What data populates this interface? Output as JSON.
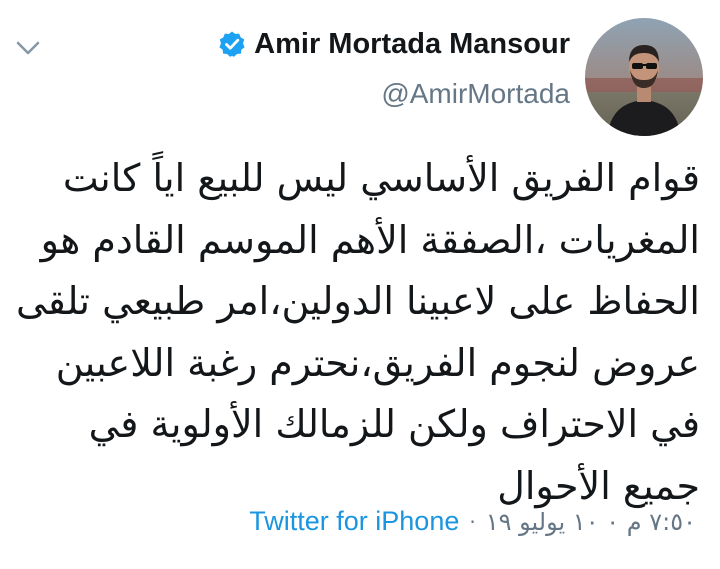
{
  "user": {
    "display_name": "Amir Mortada Mansour",
    "handle": "@AmirMortada",
    "verified": true
  },
  "icons": {
    "caret": "chevron-down-icon",
    "verified": "verified-badge-icon"
  },
  "tweet": {
    "lines": [
      "قوام الفريق الأساسي ليس للبيع اياً كانت",
      "المغريات ،الصفقة الأهم الموسم القادم هو",
      "الحفاظ على لاعبينا الدولين،امر طبيعي تلقى",
      "عروض لنجوم الفريق،نحترم رغبة اللاعبين",
      "في الاحتراف ولكن للزمالك الأولوية في",
      "جميع الأحوال"
    ]
  },
  "meta": {
    "timestamp": "٧:٥٠ م ٠ ١٠ يوليو ١٩",
    "separator": "·",
    "source": "Twitter for iPhone"
  },
  "colors": {
    "link_blue": "#1b95e0",
    "verified_blue": "#1da1f2",
    "secondary_gray": "#657786",
    "text": "#14171a"
  }
}
